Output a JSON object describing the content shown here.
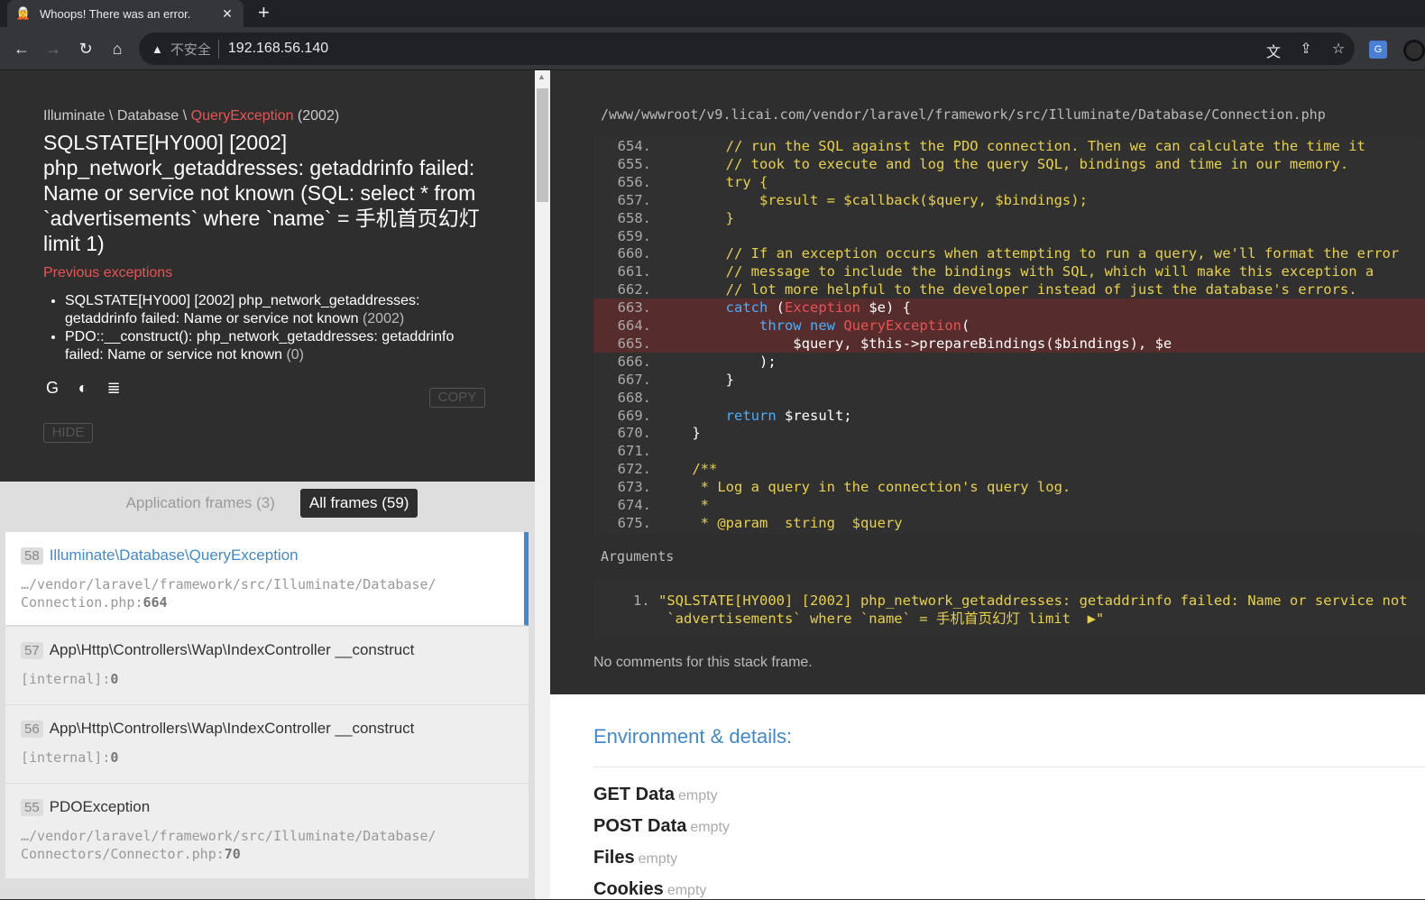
{
  "browser": {
    "tab_title": "Whoops! There was an error.",
    "tab_close": "✕",
    "new_tab": "+",
    "insecure_label": "不安全",
    "url": "192.168.56.140"
  },
  "exception": {
    "namespace": "Illuminate \\ Database \\ ",
    "class_name": "QueryException",
    "code": " (2002)",
    "message": "SQLSTATE[HY000] [2002] php_network_getaddresses: getaddrinfo failed: Name or service not known (SQL: select * from `advertisements` where `name` = 手机首页幻灯 limit 1)",
    "previous_title": "Previous exceptions",
    "previous": [
      {
        "text": "SQLSTATE[HY000] [2002] php_network_getaddresses: getaddrinfo failed: Name or service not known ",
        "code": "(2002)"
      },
      {
        "text": "PDO::__construct(): php_network_getaddresses: getaddrinfo failed: Name or service not known ",
        "code": "(0)"
      }
    ],
    "copy_label": "COPY",
    "hide_label": "HIDE"
  },
  "frame_tabs": {
    "application": "Application frames (3)",
    "all": "All frames (59)"
  },
  "frames": [
    {
      "index": "58",
      "class": "Illuminate\\Database\\QueryException",
      "file": "…/vendor/laravel/framework/src/Illuminate/Database/\nConnection.php",
      "line": "664"
    },
    {
      "index": "57",
      "class": "App\\Http\\Controllers\\Wap\\IndexController __construct",
      "file": "[internal]",
      "line": "0"
    },
    {
      "index": "56",
      "class": "App\\Http\\Controllers\\Wap\\IndexController __construct",
      "file": "[internal]",
      "line": "0"
    },
    {
      "index": "55",
      "class": "PDOException",
      "file": "…/vendor/laravel/framework/src/Illuminate/Database/\nConnectors/Connector.php",
      "line": "70"
    }
  ],
  "code": {
    "file_path": "/www/wwwroot/v9.licai.com/vendor/laravel/framework/src/Illuminate/Database/Connection.php",
    "lines": [
      {
        "n": "654.",
        "t": "        // run the SQL against the PDO connection. Then we can calculate the time it",
        "k": "comment"
      },
      {
        "n": "655.",
        "t": "        // took to execute and log the query SQL, bindings and time in our memory.",
        "k": "comment"
      },
      {
        "n": "656.",
        "t": "        try {",
        "k": "comment"
      },
      {
        "n": "657.",
        "t": "            $result = $callback($query, $bindings);",
        "k": "comment"
      },
      {
        "n": "658.",
        "t": "        }",
        "k": "comment"
      },
      {
        "n": "659.",
        "t": "",
        "k": "plain"
      },
      {
        "n": "660.",
        "t": "        // If an exception occurs when attempting to run a query, we'll format the error",
        "k": "comment"
      },
      {
        "n": "661.",
        "t": "        // message to include the bindings with SQL, which will make this exception a",
        "k": "comment"
      },
      {
        "n": "662.",
        "t": "        // lot more helpful to the developer instead of just the database's errors.",
        "k": "comment"
      },
      {
        "n": "663.",
        "t": "",
        "k": "catch"
      },
      {
        "n": "664.",
        "t": "",
        "k": "throw"
      },
      {
        "n": "665.",
        "t": "                $query, $this->prepareBindings($bindings), $e",
        "k": "plainhl"
      },
      {
        "n": "666.",
        "t": "            );",
        "k": "plain"
      },
      {
        "n": "667.",
        "t": "        }",
        "k": "plain"
      },
      {
        "n": "668.",
        "t": "",
        "k": "plain"
      },
      {
        "n": "669.",
        "t": "",
        "k": "return"
      },
      {
        "n": "670.",
        "t": "    }",
        "k": "plain"
      },
      {
        "n": "671.",
        "t": "",
        "k": "plain"
      },
      {
        "n": "672.",
        "t": "    /**",
        "k": "comment"
      },
      {
        "n": "673.",
        "t": "     * Log a query in the connection's query log.",
        "k": "comment"
      },
      {
        "n": "674.",
        "t": "     *",
        "k": "comment"
      },
      {
        "n": "675.",
        "t": "     * @param  string  $query",
        "k": "comment"
      }
    ],
    "catch_kw": "catch",
    "catch_open": " (",
    "catch_cls": "Exception",
    "catch_rest": " $e) {",
    "throw_kw": "throw",
    "new_kw": "new",
    "throw_cls": "QueryException",
    "throw_rest": "(",
    "return_kw": "return",
    "return_rest": " $result;"
  },
  "arguments": {
    "title": "Arguments",
    "num": "1.",
    "value": "\"SQLSTATE[HY000] [2002] php_network_getaddresses: getaddrinfo failed: Name or service not\n `advertisements` where `name` = 手机首页幻灯 limit  ▶\""
  },
  "no_comments": "No comments for this stack frame.",
  "environment": {
    "title": "Environment & details:",
    "rows": [
      {
        "label": "GET Data",
        "value": "empty"
      },
      {
        "label": "POST Data",
        "value": "empty"
      },
      {
        "label": "Files",
        "value": "empty"
      },
      {
        "label": "Cookies",
        "value": "empty"
      }
    ]
  }
}
